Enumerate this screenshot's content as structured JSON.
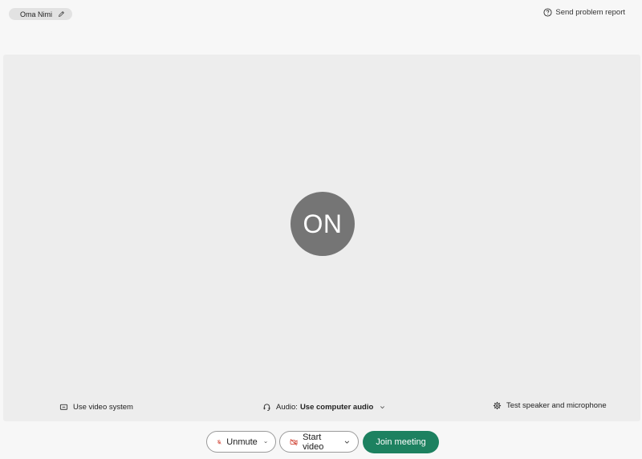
{
  "header": {
    "user_name": "Oma Nimi",
    "report_label": "Send problem report"
  },
  "preview": {
    "avatar_initials": "ON",
    "video_system_label": "Use video system",
    "audio_prefix": "Audio:",
    "audio_value": "Use computer audio",
    "test_label": "Test speaker and microphone"
  },
  "controls": {
    "unmute_label": "Unmute",
    "start_video_label": "Start video",
    "join_label": "Join meeting"
  },
  "colors": {
    "join_button": "#1d8160",
    "muted_icon": "#d24a3c",
    "avatar_bg": "#757575"
  },
  "icons": {
    "edit": "pencil-icon",
    "report": "question-circle-icon",
    "video_system": "screen-icon",
    "audio": "headset-icon",
    "test": "gear-icon",
    "unmute": "microphone-muted-icon",
    "video": "camera-off-icon",
    "dropdown": "chevron-down-icon"
  }
}
